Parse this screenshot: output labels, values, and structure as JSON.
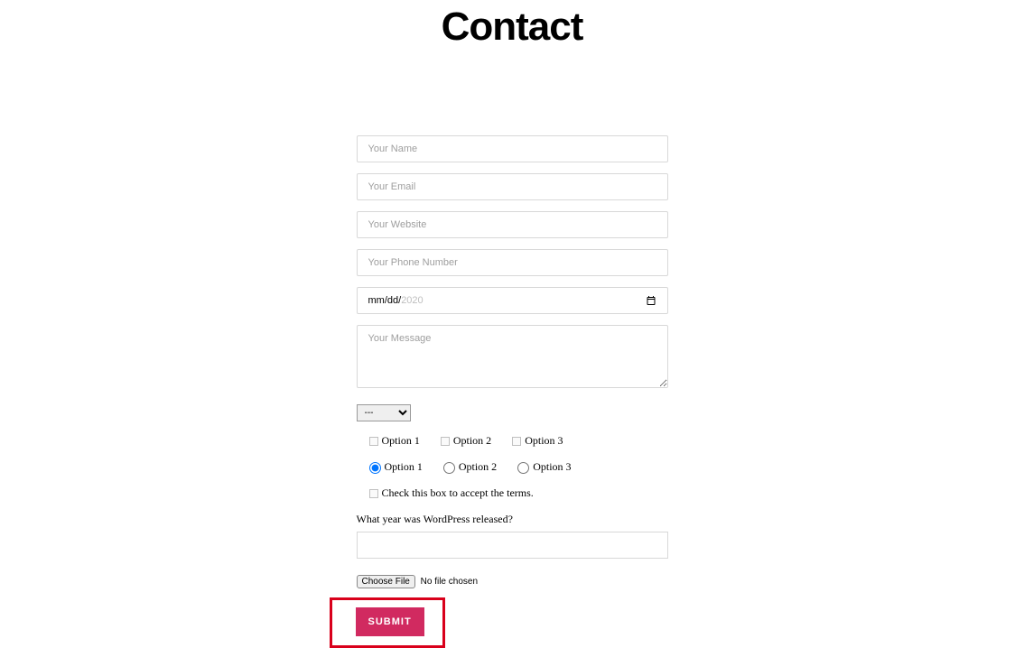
{
  "title": "Contact",
  "form": {
    "name_placeholder": "Your Name",
    "email_placeholder": "Your Email",
    "website_placeholder": "Your Website",
    "phone_placeholder": "Your Phone Number",
    "date_mmdd": "mm/dd/",
    "date_year": "2020",
    "message_placeholder": "Your Message",
    "select_default": "---",
    "checkbox_options": [
      "Option 1",
      "Option 2",
      "Option 3"
    ],
    "radio_options": [
      "Option 1",
      "Option 2",
      "Option 3"
    ],
    "radio_selected_index": 0,
    "terms_label": "Check this box to accept the terms.",
    "quiz_question": "What year was WordPress released?",
    "file_button": "Choose File",
    "file_status": "No file chosen",
    "submit_label": "SUBMIT"
  }
}
